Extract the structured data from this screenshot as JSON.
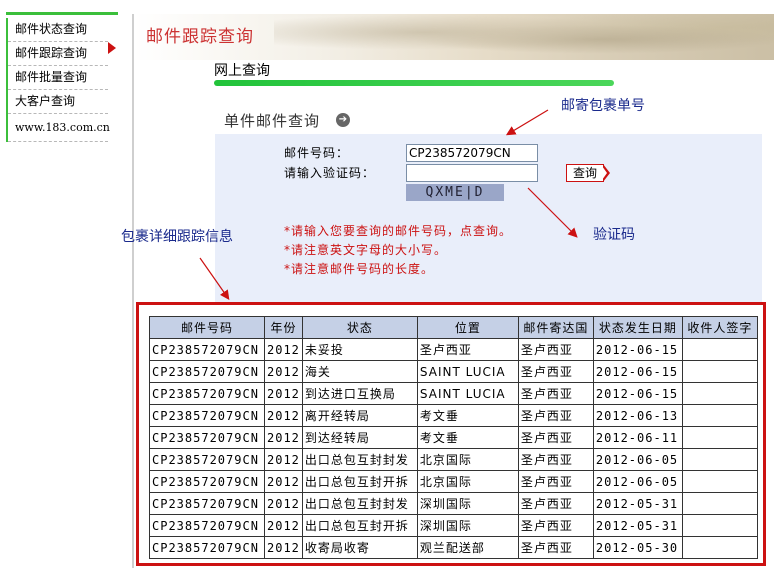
{
  "sidebar": {
    "items": [
      {
        "label": "邮件状态查询"
      },
      {
        "label": "邮件跟踪查询"
      },
      {
        "label": "邮件批量查询"
      },
      {
        "label": "大客户查询"
      },
      {
        "label": "www.183.com.cn"
      }
    ],
    "active_index": 1
  },
  "header": {
    "title": "邮件跟踪查询"
  },
  "online_query": {
    "title": "网上查询"
  },
  "single_query": {
    "title": "单件邮件查询",
    "mail_no_label": "邮件号码：",
    "mail_no_value": "CP238572079CN",
    "captcha_label": "请输入验证码：",
    "captcha_value": "",
    "captcha_image_text": "QXME|D",
    "query_button": "查询",
    "notes": [
      "*请输入您要查询的邮件号码，点查询。",
      "*请注意英文字母的大小写。",
      "*请注意邮件号码的长度。"
    ]
  },
  "annotations": {
    "parcel_number": "邮寄包裹单号",
    "captcha": "验证码",
    "tracking_info": "包裹详细跟踪信息"
  },
  "results": {
    "headers": [
      "邮件号码",
      "年份",
      "状态",
      "位置",
      "邮件寄达国",
      "状态发生日期",
      "收件人签字"
    ],
    "rows": [
      [
        "CP238572079CN",
        "2012",
        "未妥投",
        "圣卢西亚",
        "圣卢西亚",
        "2012-06-15",
        ""
      ],
      [
        "CP238572079CN",
        "2012",
        "海关",
        "SAINT LUCIA",
        "圣卢西亚",
        "2012-06-15",
        ""
      ],
      [
        "CP238572079CN",
        "2012",
        "到达进口互换局",
        "SAINT LUCIA",
        "圣卢西亚",
        "2012-06-15",
        ""
      ],
      [
        "CP238572079CN",
        "2012",
        "离开经转局",
        "考文垂",
        "圣卢西亚",
        "2012-06-13",
        ""
      ],
      [
        "CP238572079CN",
        "2012",
        "到达经转局",
        "考文垂",
        "圣卢西亚",
        "2012-06-11",
        ""
      ],
      [
        "CP238572079CN",
        "2012",
        "出口总包互封封发",
        "北京国际",
        "圣卢西亚",
        "2012-06-05",
        ""
      ],
      [
        "CP238572079CN",
        "2012",
        "出口总包互封开拆",
        "北京国际",
        "圣卢西亚",
        "2012-06-05",
        ""
      ],
      [
        "CP238572079CN",
        "2012",
        "出口总包互封封发",
        "深圳国际",
        "圣卢西亚",
        "2012-05-31",
        ""
      ],
      [
        "CP238572079CN",
        "2012",
        "出口总包互封开拆",
        "深圳国际",
        "圣卢西亚",
        "2012-05-31",
        ""
      ],
      [
        "CP238572079CN",
        "2012",
        "收寄局收寄",
        "观兰配送部",
        "圣卢西亚",
        "2012-05-30",
        ""
      ]
    ]
  },
  "colors": {
    "accent_red": "#cc1111",
    "sidebar_green": "#3bbf3b",
    "panel_blue": "#e9eefa",
    "header_blue": "#c5d0e6"
  }
}
